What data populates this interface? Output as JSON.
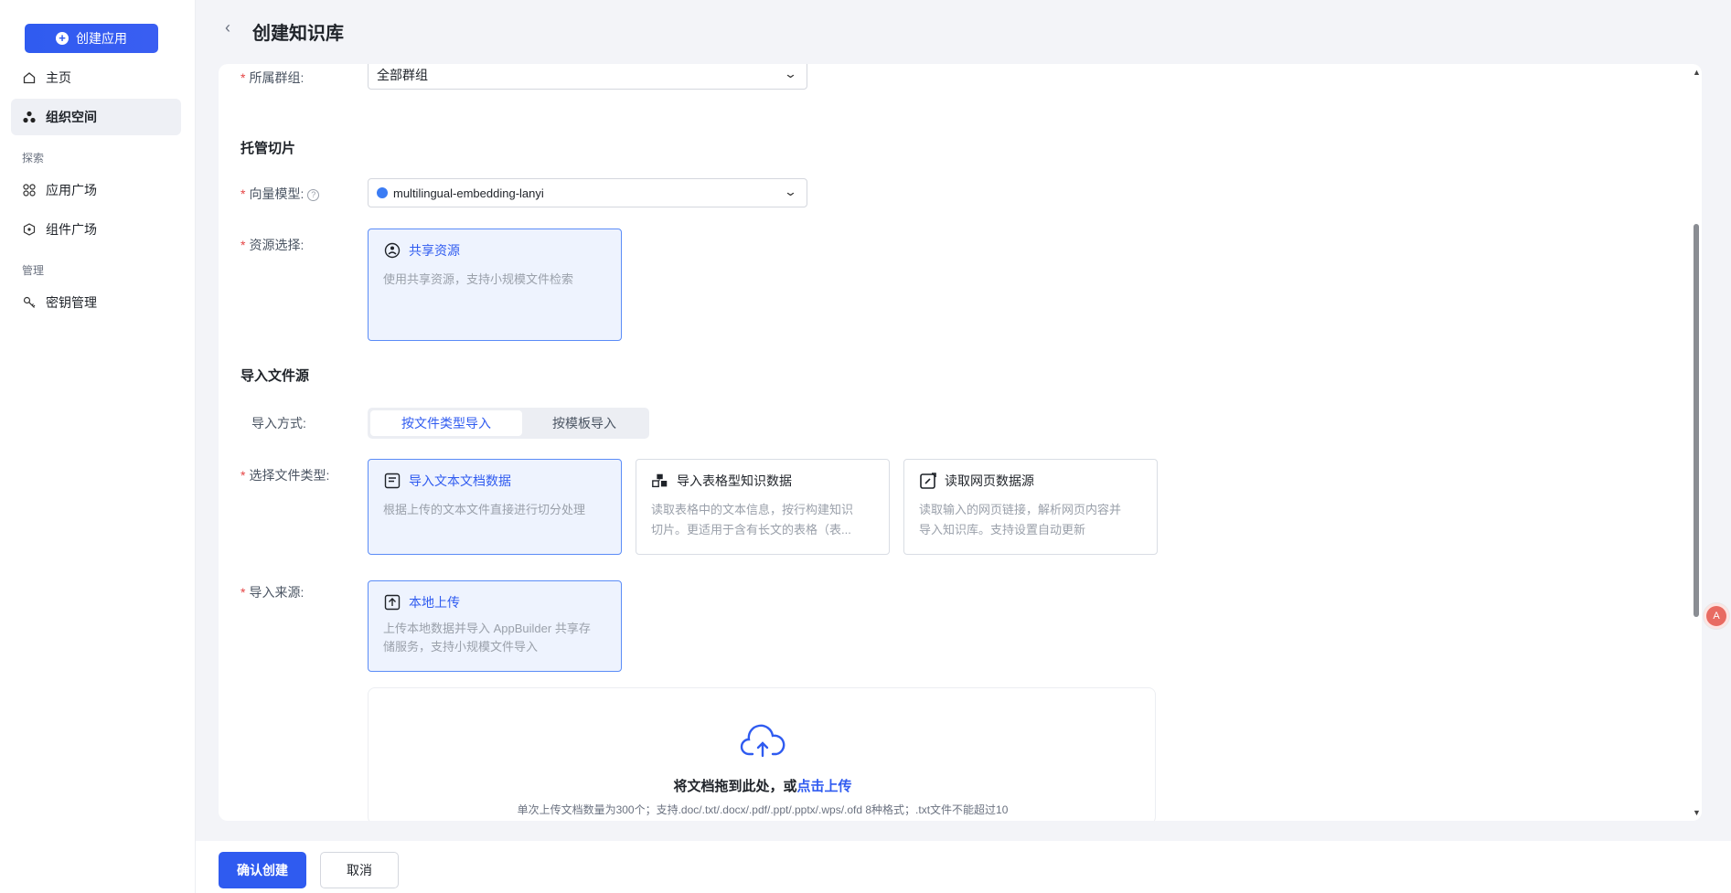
{
  "sidebar": {
    "create_label": "创建应用",
    "items": [
      {
        "label": "主页"
      },
      {
        "label": "组织空间"
      },
      {
        "label": "应用广场"
      },
      {
        "label": "组件广场"
      },
      {
        "label": "密钥管理"
      }
    ],
    "groups": {
      "explore": "探索",
      "manage": "管理"
    }
  },
  "header": {
    "title": "创建知识库"
  },
  "form": {
    "group_label": "所属群组:",
    "group_value": "全部群组",
    "section_slicing": "托管切片",
    "vector_label": "向量模型:",
    "vector_value": "multilingual-embedding-lanyi",
    "resource_label": "资源选择:",
    "resource_card": {
      "title": "共享资源",
      "desc": "使用共享资源，支持小规模文件检索"
    },
    "section_import": "导入文件源",
    "import_mode_label": "导入方式:",
    "import_modes": [
      "按文件类型导入",
      "按模板导入"
    ],
    "file_type_label": "选择文件类型:",
    "file_types": [
      {
        "title": "导入文本文档数据",
        "desc": "根据上传的文本文件直接进行切分处理"
      },
      {
        "title": "导入表格型知识数据",
        "desc1": "读取表格中的文本信息，按行构建知识",
        "desc2": "切片。更适用于含有长文的表格（表..."
      },
      {
        "title": "读取网页数据源",
        "desc1": "读取输入的网页链接，解析网页内容并",
        "desc2": "导入知识库。支持设置自动更新"
      }
    ],
    "source_label": "导入来源:",
    "source_card": {
      "title": "本地上传",
      "desc1": "上传本地数据并导入 AppBuilder 共享存",
      "desc2": "储服务，支持小规模文件导入"
    },
    "upload": {
      "title_prefix": "将文档拖到此处，或",
      "title_link": "点击上传",
      "hint": "单次上传文档数量为300个；支持.doc/.txt/.docx/.pdf/.ppt/.pptx/.wps/.ofd 8种格式；.txt文件不能超过10"
    }
  },
  "footer": {
    "confirm": "确认创建",
    "cancel": "取消"
  },
  "float_badge": "A",
  "colors": {
    "primary": "#2f5bf0",
    "required": "#e54545"
  }
}
